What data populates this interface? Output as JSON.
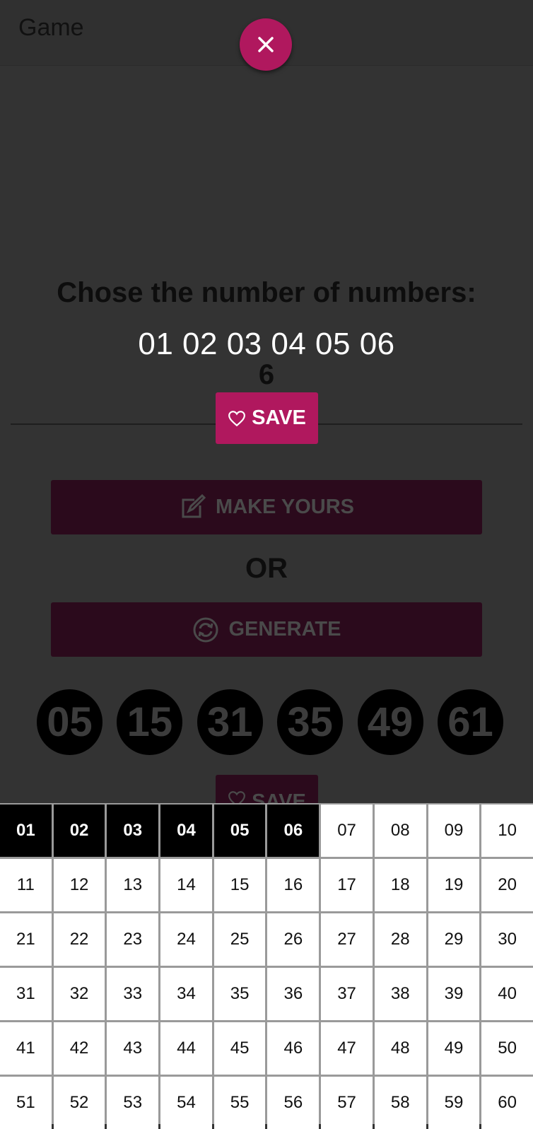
{
  "appbar": {
    "title": "Game"
  },
  "icons": {
    "close": "close-icon",
    "heart": "heart-outline-icon",
    "edit": "edit-icon",
    "refresh": "refresh-icon"
  },
  "colors": {
    "accent": "#b0185e",
    "background": "#333333",
    "selected_cell": "#000000"
  },
  "main": {
    "heading": "Chose the number of numbers:",
    "selected_numbers": "01 02 03 04 05 06",
    "count": "6",
    "save_label": "SAVE",
    "make_yours_label": "MAKE YOURS",
    "or_label": "OR",
    "generate_label": "GENERATE",
    "generated_numbers": [
      "05",
      "15",
      "31",
      "35",
      "49",
      "61"
    ],
    "save_label_2": "SAVE"
  },
  "number_grid": {
    "cells": [
      "01",
      "02",
      "03",
      "04",
      "05",
      "06",
      "07",
      "08",
      "09",
      "10",
      "11",
      "12",
      "13",
      "14",
      "15",
      "16",
      "17",
      "18",
      "19",
      "20",
      "21",
      "22",
      "23",
      "24",
      "25",
      "26",
      "27",
      "28",
      "29",
      "30",
      "31",
      "32",
      "33",
      "34",
      "35",
      "36",
      "37",
      "38",
      "39",
      "40",
      "41",
      "42",
      "43",
      "44",
      "45",
      "46",
      "47",
      "48",
      "49",
      "50",
      "51",
      "52",
      "53",
      "54",
      "55",
      "56",
      "57",
      "58",
      "59",
      "60"
    ],
    "selected": [
      "01",
      "02",
      "03",
      "04",
      "05",
      "06"
    ]
  }
}
